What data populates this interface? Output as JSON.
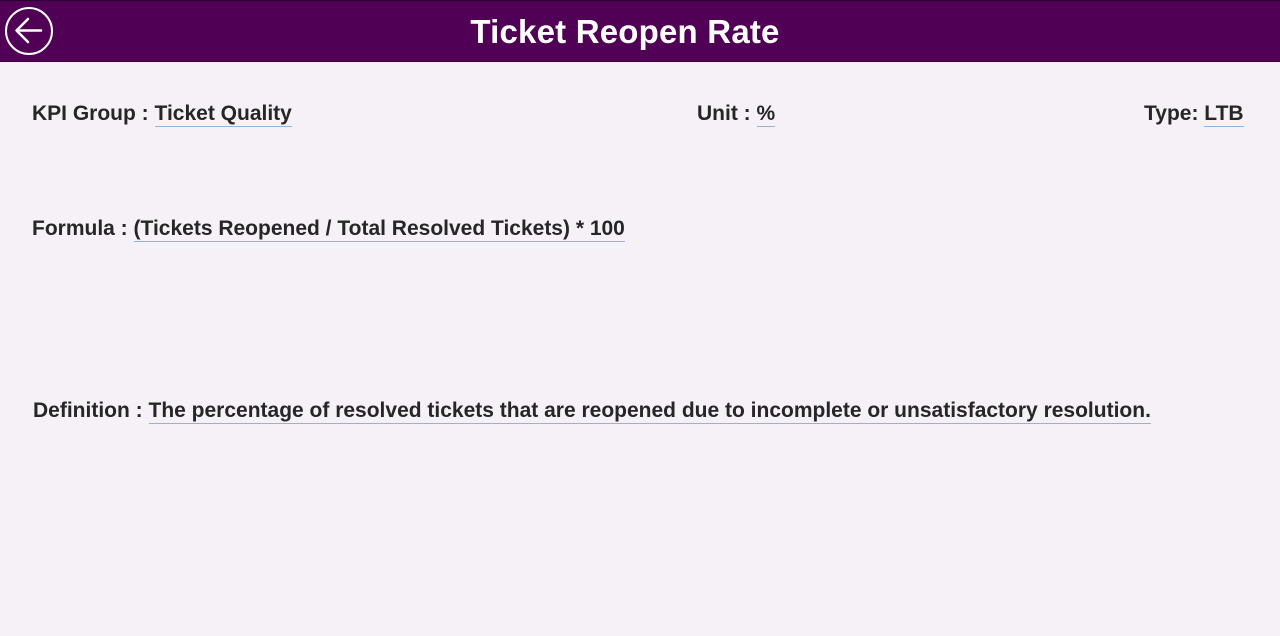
{
  "header": {
    "title": "Ticket Reopen Rate",
    "back_icon": "arrow-left-circle",
    "background_color": "#500055"
  },
  "kpi": {
    "group_label": "KPI Group :",
    "group_value": "Ticket Quality",
    "unit_label": "Unit :",
    "unit_value": "%",
    "type_label": "Type:",
    "type_value": "LTB",
    "formula_label": "Formula :",
    "formula_value": "(Tickets Reopened / Total Resolved Tickets) * 100",
    "definition_label": "Definition :",
    "definition_value": "The percentage of resolved tickets that are reopened due to incomplete or unsatisfactory resolution."
  }
}
